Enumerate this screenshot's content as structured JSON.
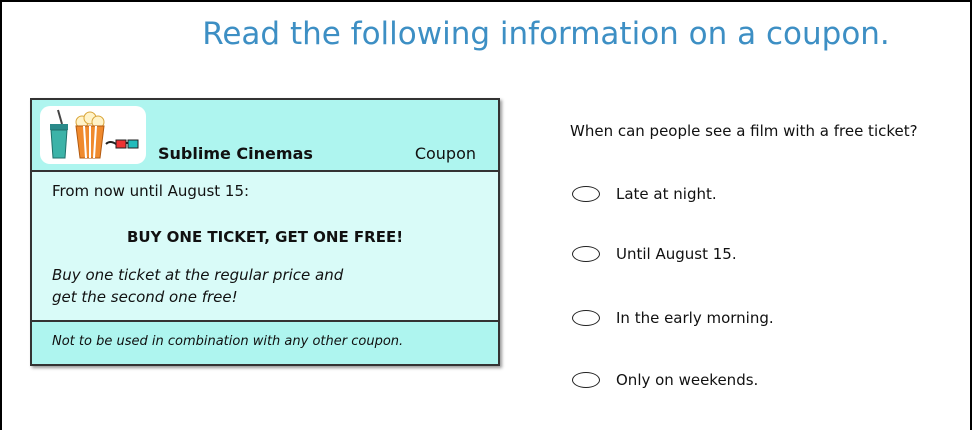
{
  "title": "Read the following information on a coupon.",
  "coupon": {
    "brand": "Sublime Cinemas",
    "label": "Coupon",
    "valid": "From now until August 15:",
    "offer": "BUY ONE TICKET, GET ONE FREE!",
    "desc_line1": "Buy one ticket at the regular price and",
    "desc_line2": "get the second one free!",
    "fine_print": "Not to be used in combination with any other coupon.",
    "icons": [
      "drink-cup-icon",
      "popcorn-icon",
      "3d-glasses-icon"
    ],
    "colors": {
      "background": "#aef5ef",
      "body": "#d9fbf8"
    }
  },
  "question": {
    "text": "When can people see a film with a free ticket?",
    "options": [
      "Late at night.",
      "Until August 15.",
      "In the early morning.",
      "Only on weekends."
    ]
  },
  "accent_color": "#3d8fc4"
}
